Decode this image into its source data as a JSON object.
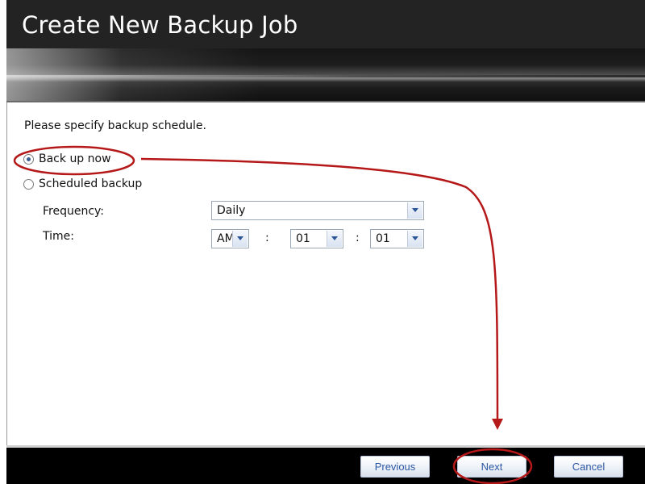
{
  "window": {
    "title": "Create New Backup Job"
  },
  "content": {
    "instruction": "Please specify backup schedule.",
    "options": [
      {
        "label": "Back up now",
        "selected": true
      },
      {
        "label": "Scheduled backup",
        "selected": false
      }
    ],
    "frequency": {
      "label": "Frequency:",
      "value": "Daily"
    },
    "time": {
      "label": "Time:",
      "ampm": "AM",
      "hour": "01",
      "minute": "01",
      "separator": ":"
    }
  },
  "footer": {
    "previous_label": "Previous",
    "next_label": "Next",
    "cancel_label": "Cancel"
  },
  "colors": {
    "annotation": "#b51818",
    "button_text": "#2b57a3",
    "dropdown_arrow": "#2a5597"
  }
}
